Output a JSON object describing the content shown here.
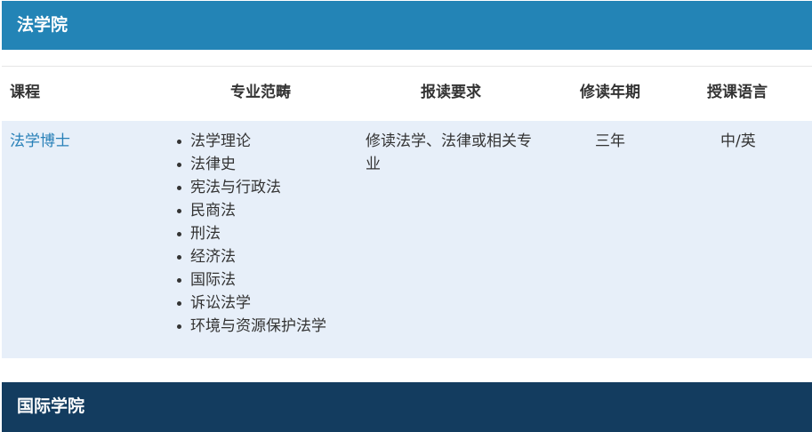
{
  "sections": [
    {
      "title": "法学院"
    },
    {
      "title": "国际学院"
    }
  ],
  "table": {
    "headers": [
      "课程",
      "专业范畴",
      "报读要求",
      "修读年期",
      "授课语言"
    ],
    "rows": [
      {
        "course": "法学博士",
        "areas": [
          "法学理论",
          "法律史",
          "宪法与行政法",
          "民商法",
          "刑法",
          "经济法",
          "国际法",
          "诉讼法学",
          "环境与资源保护法学"
        ],
        "requirement": "修读法学、法律或相关专业",
        "duration": "三年",
        "language": "中/英"
      }
    ]
  },
  "colors": {
    "law_header": "#2384b6",
    "intl_header": "#133c5f",
    "row_bg": "#e7eff9",
    "link": "#2880b8"
  }
}
